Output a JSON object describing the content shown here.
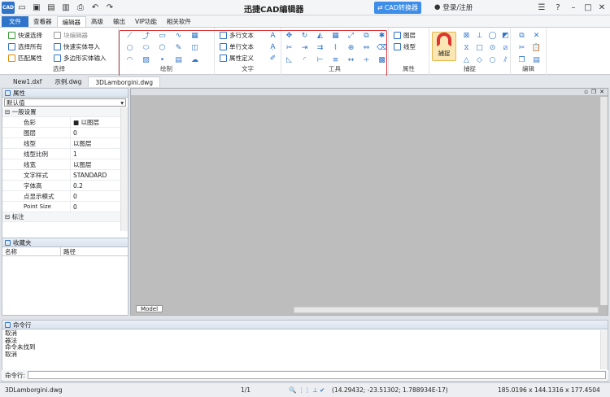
{
  "app": {
    "title": "迅捷CAD编辑器",
    "converter_label": "CAD转换器",
    "login_label": "登录/注册",
    "logo_text": "CAD"
  },
  "ribbon_tabs": [
    {
      "label": "文件"
    },
    {
      "label": "查看器"
    },
    {
      "label": "编辑器"
    },
    {
      "label": "高级"
    },
    {
      "label": "输出"
    },
    {
      "label": "VIP功能"
    },
    {
      "label": "相关软件"
    }
  ],
  "ribbon": {
    "select_group": {
      "label": "选择",
      "items": [
        "快速选择",
        "选择所有",
        "匹配属性",
        "块编辑器",
        "快速实体导入",
        "多边形实体输入"
      ]
    },
    "draw_group": {
      "label": "绘制"
    },
    "text_group": {
      "label": "文字",
      "items": [
        "多行文本",
        "单行文本",
        "属性定义"
      ]
    },
    "tools_group": {
      "label": "工具"
    },
    "props_group": {
      "label": "属性",
      "items": [
        "图层",
        "线型"
      ]
    },
    "snap_group": {
      "label": "捕捉",
      "button_label": "捕捉"
    },
    "edit_group": {
      "label": "编辑"
    }
  },
  "doc_tabs": [
    {
      "label": "New1.dxf"
    },
    {
      "label": "示例.dwg"
    },
    {
      "label": "3DLamborgini.dwg"
    }
  ],
  "properties_panel": {
    "title": "属性",
    "selector_value": "默认值",
    "group_general": "一般设置",
    "rows": [
      {
        "key": "色彩",
        "value": "■ 以图层"
      },
      {
        "key": "图层",
        "value": "0"
      },
      {
        "key": "线型",
        "value": "以图层"
      },
      {
        "key": "线型比例",
        "value": "1"
      },
      {
        "key": "线宽",
        "value": "以图层"
      },
      {
        "key": "文字样式",
        "value": "STANDARD"
      },
      {
        "key": "字体高",
        "value": "0.2"
      },
      {
        "key": "点显示模式",
        "value": "0"
      },
      {
        "key": "Point Size",
        "value": "0"
      }
    ],
    "group_annotation": "标注"
  },
  "favorites_panel": {
    "title": "收藏夹",
    "col_name": "名称",
    "col_path": "路径"
  },
  "canvas": {
    "model_tab": "Model"
  },
  "command_panel": {
    "title": "命令行",
    "lines": [
      "取消",
      "器法",
      "命令未找到",
      "取消"
    ],
    "input_label": "命令行:"
  },
  "status": {
    "file": "3DLamborgini.dwg",
    "page": "1/1",
    "coords": "(14.29432; -23.51302; 1.788934E-17)",
    "dims": "185.0196 x 144.1316 x 177.4504"
  }
}
